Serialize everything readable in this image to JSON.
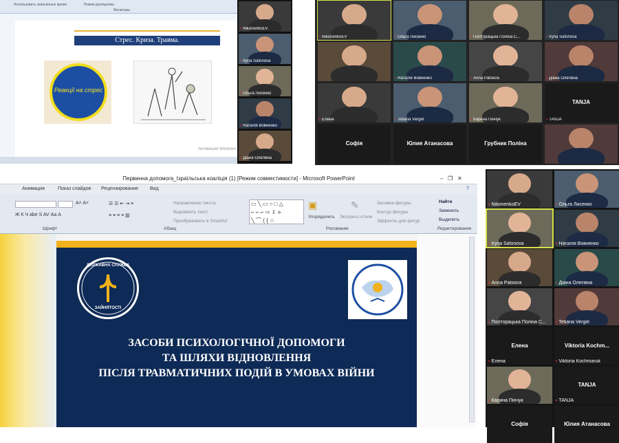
{
  "top_left_ppt": {
    "ribbon_items": [
      "Использовать записанные время",
      "Режим докладчика",
      "Мониторы"
    ],
    "slide_heading": "Стрес. Криза. Травма.",
    "circle_text": "Реакції на стрес",
    "status_text": "Активация Windows"
  },
  "top_sidebar": {
    "tiles": [
      {
        "name": "NikonenkoEV"
      },
      {
        "name": "Iryna Safonova"
      },
      {
        "name": "Ольга Лисенко"
      },
      {
        "name": "Наталія Вовненко"
      },
      {
        "name": "Діана Олегівна"
      }
    ]
  },
  "top_grid": {
    "tiles": [
      {
        "name": "NikonenkoEV",
        "big": ""
      },
      {
        "name": "Ольга Лисенко",
        "big": ""
      },
      {
        "name": "Полторацька Поліна С...",
        "big": ""
      },
      {
        "name": "Iryna Safonova",
        "big": ""
      },
      {
        "name": "",
        "big": ""
      },
      {
        "name": "Наталія Вовненко",
        "big": ""
      },
      {
        "name": "Anna Patsiora",
        "big": ""
      },
      {
        "name": "Діана Олегівна",
        "big": ""
      },
      {
        "name": "Елена",
        "big": ""
      },
      {
        "name": "Tetiana Vergel",
        "big": ""
      },
      {
        "name": "Карина Пінчук",
        "big": ""
      },
      {
        "name": "TANJA",
        "big": "TANJA"
      },
      {
        "name": "",
        "big": "Софія"
      },
      {
        "name": "",
        "big": "Юлия Атанасова"
      },
      {
        "name": "",
        "big": "Грубник Поліна"
      },
      {
        "name": "",
        "big": ""
      }
    ]
  },
  "bottom_ppt": {
    "window_title": "Первинна допомога_Ізраїльська коаліція (1) [Режим совместимости] - Microsoft PowerPoint",
    "menu": [
      "Анимация",
      "Показ слайдов",
      "Рецензирование",
      "Вид"
    ],
    "ribbon": {
      "text_direction": "Направление текста",
      "align_text": "Выровнять текст",
      "smartart": "Преобразовать в SmartArt",
      "arrange": "Упорядочить",
      "quick_styles": "Экспресс-стили",
      "fill": "Заливка фигуры",
      "outline": "Контур фигуры",
      "effects": "Эффекты для фигур",
      "find": "Найти",
      "replace": "Заменить",
      "select": "Выделить",
      "group_font": "Шрифт",
      "group_paragraph": "Абзац",
      "group_drawing": "Рисование",
      "group_editing": "Редактирование"
    },
    "slide": {
      "logo_top": "ДЕРЖАВНА СЛУЖБА",
      "logo_bottom": "ЗАЙНЯТОСТІ",
      "title_lines": [
        "ЗАСОБИ ПСИХОЛОГІЧНОЇ ДОПОМОГИ",
        "ТА ШЛЯХИ ВІДНОВЛЕННЯ",
        "ПІСЛЯ ТРАВМАТИЧНИХ ПОДІЙ В УМОВАХ ВІЙНИ"
      ]
    }
  },
  "bottom_sidebar": {
    "tiles": [
      {
        "name": "NikonenkoEV",
        "big": ""
      },
      {
        "name": "Ольга Лисенко",
        "big": ""
      },
      {
        "name": "Iryna Safonova",
        "big": ""
      },
      {
        "name": "Наталія Вовненко",
        "big": ""
      },
      {
        "name": "Anna Patsiora",
        "big": ""
      },
      {
        "name": "Діана Олегівна",
        "big": ""
      },
      {
        "name": "Полторацька Поліна С...",
        "big": ""
      },
      {
        "name": "Tetiana Vergel",
        "big": ""
      },
      {
        "name": "Елена",
        "big": "Елена"
      },
      {
        "name": "Viktoria Kochmaruk",
        "big": "Viktoria Kochm..."
      },
      {
        "name": "Карина Пінчук",
        "big": ""
      },
      {
        "name": "TANJA",
        "big": "TANJA"
      },
      {
        "name": "",
        "big": "Софія"
      },
      {
        "name": "",
        "big": "Юлия Атанасова"
      }
    ]
  },
  "colors": {
    "slide_bg": "#0e2a56",
    "gold": "#f2b21b",
    "active_border": "#d8e34a"
  }
}
